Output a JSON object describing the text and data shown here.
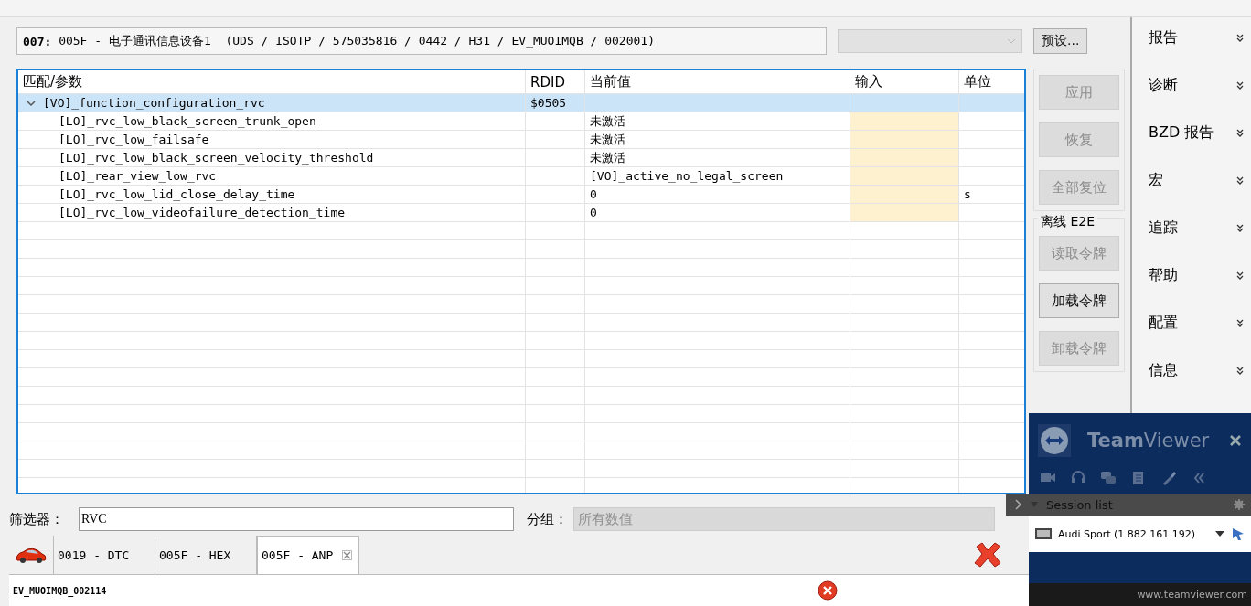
{
  "ecu": {
    "address": "007:",
    "description": "005F - 电子通讯信息设备1  (UDS / ISOTP / 575035816 / 0442 / H31 / EV_MUOIMQB / 002001)"
  },
  "preset_button": "预设...",
  "sidebar": {
    "items": [
      {
        "label": "报告"
      },
      {
        "label": "诊断"
      },
      {
        "label": "BZD 报告"
      },
      {
        "label": "宏"
      },
      {
        "label": "追踪"
      },
      {
        "label": "帮助"
      },
      {
        "label": "配置"
      },
      {
        "label": "信息"
      }
    ]
  },
  "table": {
    "columns": [
      "匹配/参数",
      "RDID",
      "当前值",
      "输入",
      "单位"
    ],
    "rows": [
      {
        "param": "[VO]_function_configuration_rvc",
        "rdid": "$0505",
        "expanded": true,
        "selected": true,
        "children": [
          {
            "param": "[LO]_rvc_low_black_screen_trunk_open",
            "value": "未激活",
            "selected": false
          },
          {
            "param": "[LO]_rvc_low_failsafe",
            "value": "未激活",
            "selected": false
          },
          {
            "param": "[LO]_rvc_low_black_screen_velocity_threshold",
            "value": "未激活",
            "selected": false
          },
          {
            "param": "[LO]_rear_view_low_rvc",
            "value": "[VO]_active_no_legal_screen",
            "selected": false
          },
          {
            "param": "[LO]_rvc_low_lid_close_delay_time",
            "value": "0",
            "unit": "s",
            "selected": false
          },
          {
            "param": "[LO]_rvc_low_videofailure_detection_time",
            "value": "0",
            "selected": false
          }
        ]
      }
    ]
  },
  "actions": [
    {
      "label": "应用",
      "disabled": true
    },
    {
      "label": "恢复",
      "disabled": true
    },
    {
      "label": "全部复位",
      "disabled": true
    }
  ],
  "e2e": {
    "title": "离线 E2E",
    "buttons": [
      {
        "label": "读取令牌",
        "disabled": true
      },
      {
        "label": "加载令牌",
        "disabled": false
      },
      {
        "label": "卸载令牌",
        "disabled": true
      }
    ]
  },
  "filter": {
    "label": "筛选器：",
    "value": "RVC"
  },
  "group": {
    "label": "分组：",
    "value": "所有数值",
    "disabled": true
  },
  "tabs": [
    {
      "label": "0019 - DTC",
      "selected": false,
      "closable": false
    },
    {
      "label": "005F - HEX",
      "selected": false,
      "closable": false
    },
    {
      "label": "005F - ANP",
      "selected": true,
      "closable": true
    }
  ],
  "status_bar": {
    "text": "EV_MUOIMQB_002114"
  },
  "teamviewer": {
    "title_bold": "Team",
    "title_rest": "Viewer",
    "section": "Session list",
    "session": "Audi Sport (1 882 161 192)",
    "footer": "www.teamviewer.com"
  }
}
